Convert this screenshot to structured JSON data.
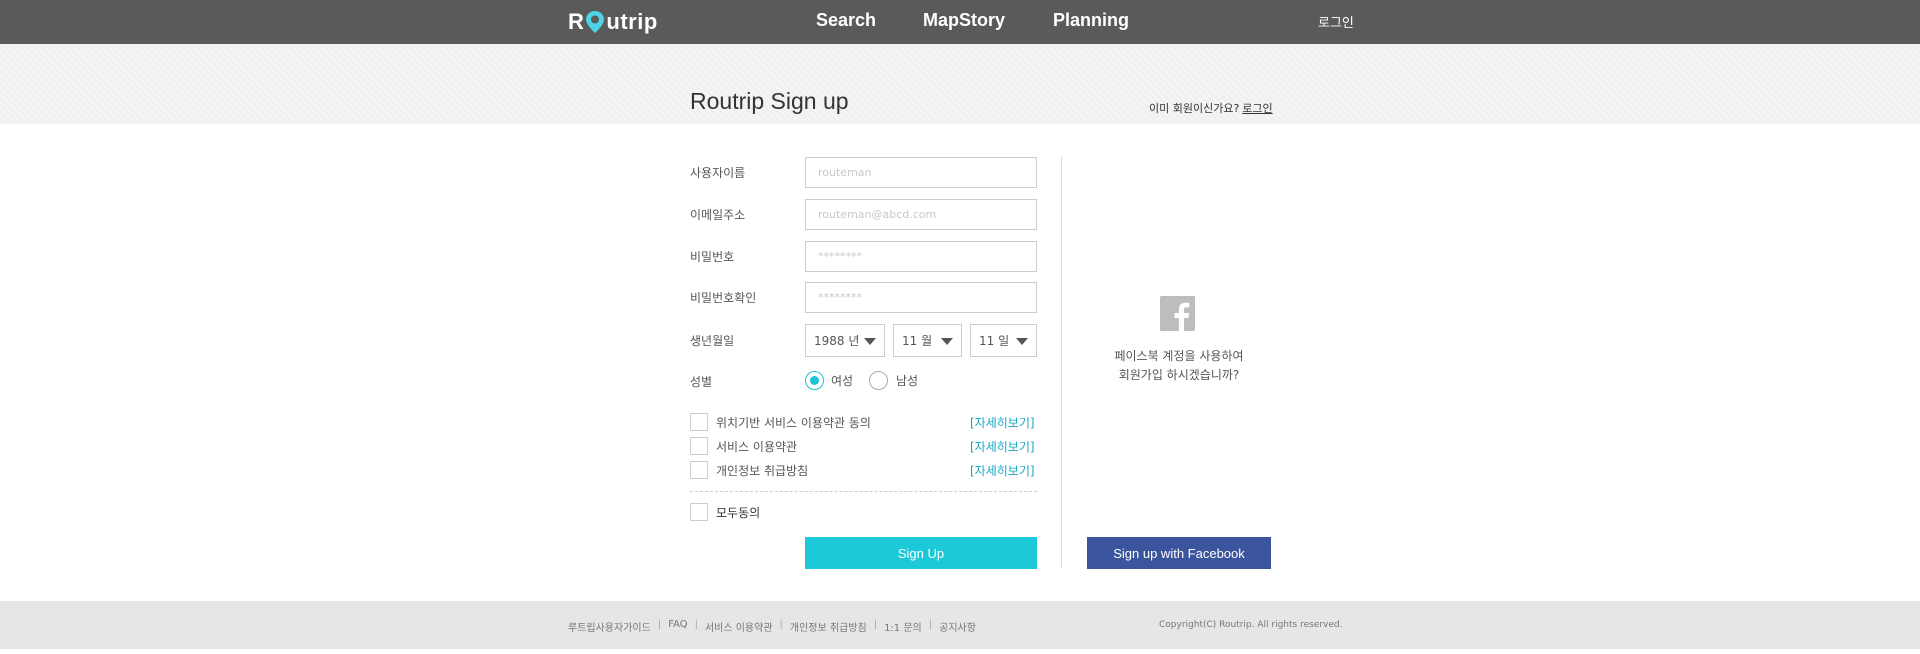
{
  "header": {
    "logo_prefix": "R",
    "logo_suffix": "utrip",
    "nav": [
      "Search",
      "MapStory",
      "Planning"
    ],
    "login": "로그인"
  },
  "page": {
    "title": "Routrip Sign up",
    "already_member": "이미 회원이신가요?",
    "login_link": "로그인"
  },
  "form": {
    "username_label": "사용자이름",
    "username_placeholder": "routeman",
    "email_label": "이메일주소",
    "email_placeholder": "routeman@abcd.com",
    "password_label": "비밀번호",
    "password_placeholder": "********",
    "password_confirm_label": "비밀번호확인",
    "password_confirm_placeholder": "********",
    "birth_label": "생년월일",
    "birth_year": "1988 년",
    "birth_month": "11 월",
    "birth_day": "11 일",
    "gender_label": "성별",
    "gender_female": "여성",
    "gender_male": "남성",
    "selected_gender": "female",
    "terms": [
      {
        "label": "위치기반 서비스 이용약관 동의",
        "detail": "[자세히보기]"
      },
      {
        "label": "서비스 이용약관",
        "detail": "[자세히보기]"
      },
      {
        "label": "개인정보 취급방침",
        "detail": "[자세히보기]"
      }
    ],
    "agree_all": "모두동의",
    "submit": "Sign Up"
  },
  "facebook": {
    "prompt_line1": "페이스북 계정을 사용하여",
    "prompt_line2": "회원가입 하시겠습니까?",
    "button": "Sign up with Facebook"
  },
  "footer": {
    "links": [
      "루트립사용자가이드",
      "FAQ",
      "서비스 이용약관",
      "개인정보 취급방침",
      "1:1 문의",
      "공지사항"
    ],
    "copyright": "Copyright(C) Routrip. All rights reserved."
  },
  "colors": {
    "accent": "#1cc9d9",
    "facebook": "#3b549e",
    "topbar": "#5a5a5a"
  }
}
